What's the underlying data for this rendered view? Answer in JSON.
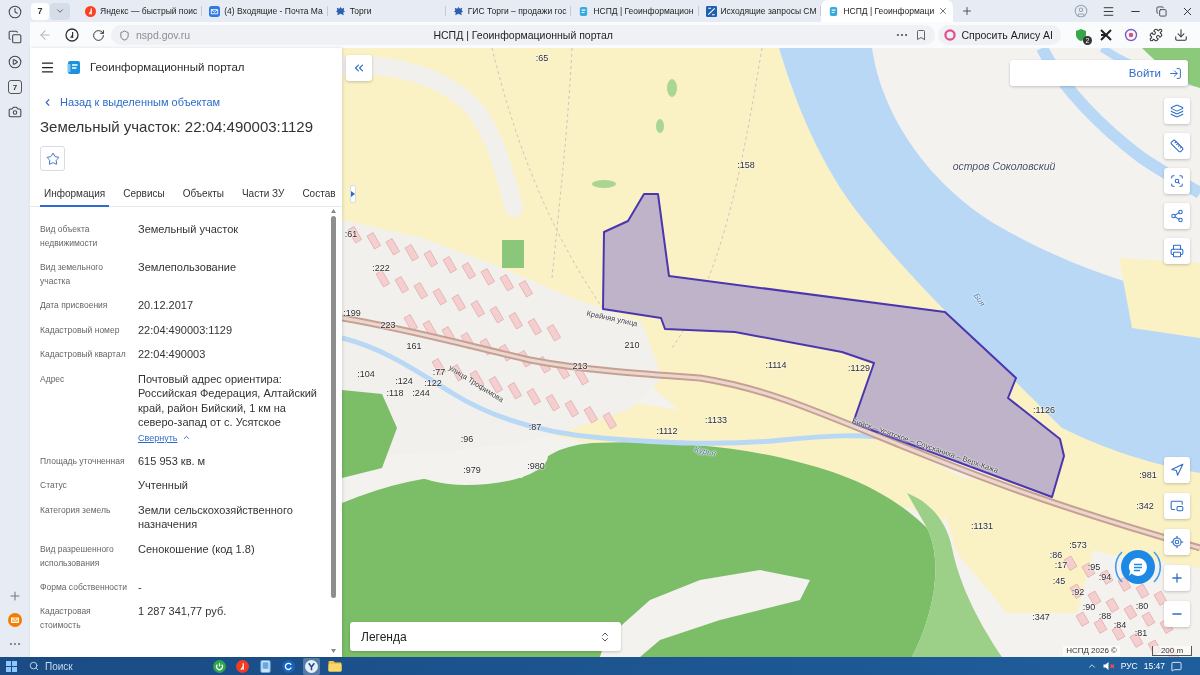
{
  "browser": {
    "sidebar_badge": "7",
    "tab_count": "7",
    "tabs": [
      {
        "title": "Яндекс — быстрый поис",
        "kind": "search",
        "selected": false
      },
      {
        "title": "(4) Входящие - Почта Ма",
        "kind": "mail",
        "selected": false
      },
      {
        "title": "Торги",
        "kind": "emblem",
        "selected": false
      },
      {
        "title": "ГИС Торги – продажи гос",
        "kind": "emblem",
        "selected": false
      },
      {
        "title": "НСПД | Геоинформацион",
        "kind": "portal",
        "selected": false
      },
      {
        "title": "Исходящие запросы СМ",
        "kind": "document",
        "selected": false
      },
      {
        "title": "НСПД | Геоинформаци",
        "kind": "portal",
        "selected": true
      }
    ],
    "url": "nspd.gov.ru",
    "page_title": "НСПД | Геоинформационный портал",
    "assistant_button": "Спросить Алису AI",
    "extension_badge": "2"
  },
  "portal": {
    "title": "Геоинформационный портал",
    "back_link": "Назад к выделенным объектам",
    "heading": "Земельный участок: 22:04:490003:1129",
    "favorite": false,
    "tabs": [
      {
        "label": "Информация",
        "selected": true
      },
      {
        "label": "Сервисы",
        "selected": false
      },
      {
        "label": "Объекты",
        "selected": false
      },
      {
        "label": "Части ЗУ",
        "selected": false
      },
      {
        "label": "Состав",
        "selected": false
      }
    ],
    "properties": [
      {
        "label": "Вид объекта недвижимости",
        "value": "Земельный участок"
      },
      {
        "label": "Вид земельного участка",
        "value": "Землепользование"
      },
      {
        "label": "Дата присвоения",
        "value": "20.12.2017"
      },
      {
        "label": "Кадастровый номер",
        "value": "22:04:490003:1129"
      },
      {
        "label": "Кадастровый квартал",
        "value": "22:04:490003"
      },
      {
        "label": "Адрес",
        "value": "Почтовый адрес ориентира: Российская Федерация, Алтайский край, район Бийский, 1 км на северо-запад от с. Усятское",
        "toggle": "Свернуть",
        "expanded": true
      },
      {
        "label": "Площадь уточненная",
        "value": "615 953 кв. м"
      },
      {
        "label": "Статус",
        "value": "Учтенный"
      },
      {
        "label": "Категория земель",
        "value": "Земли сельскохозяйственного назначения"
      },
      {
        "label": "Вид разрешенного использования",
        "value": "Сенокошение (код 1.8)"
      },
      {
        "label": "Форма собственности",
        "value": "-"
      },
      {
        "label": "Кадастровая стоимость",
        "value": "1 287 341,77 руб."
      }
    ]
  },
  "map": {
    "login_button": "Войти",
    "legend": "Легенда",
    "attribution": "НСПД 2026 ©",
    "scale": "200 m",
    "labels": [
      {
        "text": ":65",
        "kind": "parcel"
      },
      {
        "text": ":158",
        "kind": "parcel"
      },
      {
        "text": "остров Соколовский",
        "kind": "place"
      },
      {
        "text": "Бия",
        "kind": "water"
      },
      {
        "text": ":1114",
        "kind": "parcel"
      },
      {
        "text": ":1129",
        "kind": "parcel"
      },
      {
        "text": ":1126",
        "kind": "parcel"
      },
      {
        "text": ":1133",
        "kind": "parcel"
      },
      {
        "text": ":1112",
        "kind": "parcel"
      },
      {
        "text": ":1131",
        "kind": "parcel"
      },
      {
        "text": ":981",
        "kind": "parcel"
      },
      {
        "text": ":342",
        "kind": "parcel"
      },
      {
        "text": ":573",
        "kind": "parcel"
      },
      {
        "text": ":347",
        "kind": "parcel"
      },
      {
        "text": ":979",
        "kind": "parcel"
      },
      {
        "text": ":980",
        "kind": "parcel"
      },
      {
        "text": ":61",
        "kind": "parcel"
      },
      {
        "text": ":222",
        "kind": "parcel"
      },
      {
        "text": ":199",
        "kind": "parcel"
      },
      {
        "text": "223",
        "kind": "parcel"
      },
      {
        "text": "161",
        "kind": "parcel"
      },
      {
        "text": ":104",
        "kind": "parcel"
      },
      {
        "text": ":124",
        "kind": "parcel"
      },
      {
        "text": ":122",
        "kind": "parcel"
      },
      {
        "text": ":118",
        "kind": "parcel"
      },
      {
        "text": ":244",
        "kind": "parcel"
      },
      {
        "text": ":77",
        "kind": "parcel"
      },
      {
        "text": "213",
        "kind": "parcel"
      },
      {
        "text": "210",
        "kind": "parcel"
      },
      {
        "text": ":96",
        "kind": "parcel"
      },
      {
        "text": ":87",
        "kind": "parcel"
      },
      {
        "text": "Крайняя улица",
        "kind": "street"
      },
      {
        "text": "улица Трофимова",
        "kind": "street"
      },
      {
        "text": "Бийск – Усятское – Соусканиха – Верх-Кажа",
        "kind": "street"
      },
      {
        "text": "Курья",
        "kind": "water"
      },
      {
        "text": ":86",
        "kind": "parcel"
      },
      {
        "text": ":17",
        "kind": "parcel"
      },
      {
        "text": ":45",
        "kind": "parcel"
      },
      {
        "text": ":92",
        "kind": "parcel"
      },
      {
        "text": ":90",
        "kind": "parcel"
      },
      {
        "text": ":88",
        "kind": "parcel"
      },
      {
        "text": ":84",
        "kind": "parcel"
      },
      {
        "text": ":81",
        "kind": "parcel"
      },
      {
        "text": ":95",
        "kind": "parcel"
      },
      {
        "text": ":94",
        "kind": "parcel"
      },
      {
        "text": ":80",
        "kind": "parcel"
      }
    ]
  },
  "taskbar": {
    "search": {
      "placeholder": "Поиск"
    },
    "apps": [
      {
        "kind": "power",
        "active": false
      },
      {
        "kind": "disc",
        "active": false
      },
      {
        "kind": "tablet",
        "active": false
      },
      {
        "kind": "refresh",
        "active": false
      },
      {
        "kind": "browser",
        "active": true
      },
      {
        "kind": "folder",
        "active": false
      }
    ],
    "sound_muted": true,
    "language": "РУС",
    "time": "15:47"
  }
}
